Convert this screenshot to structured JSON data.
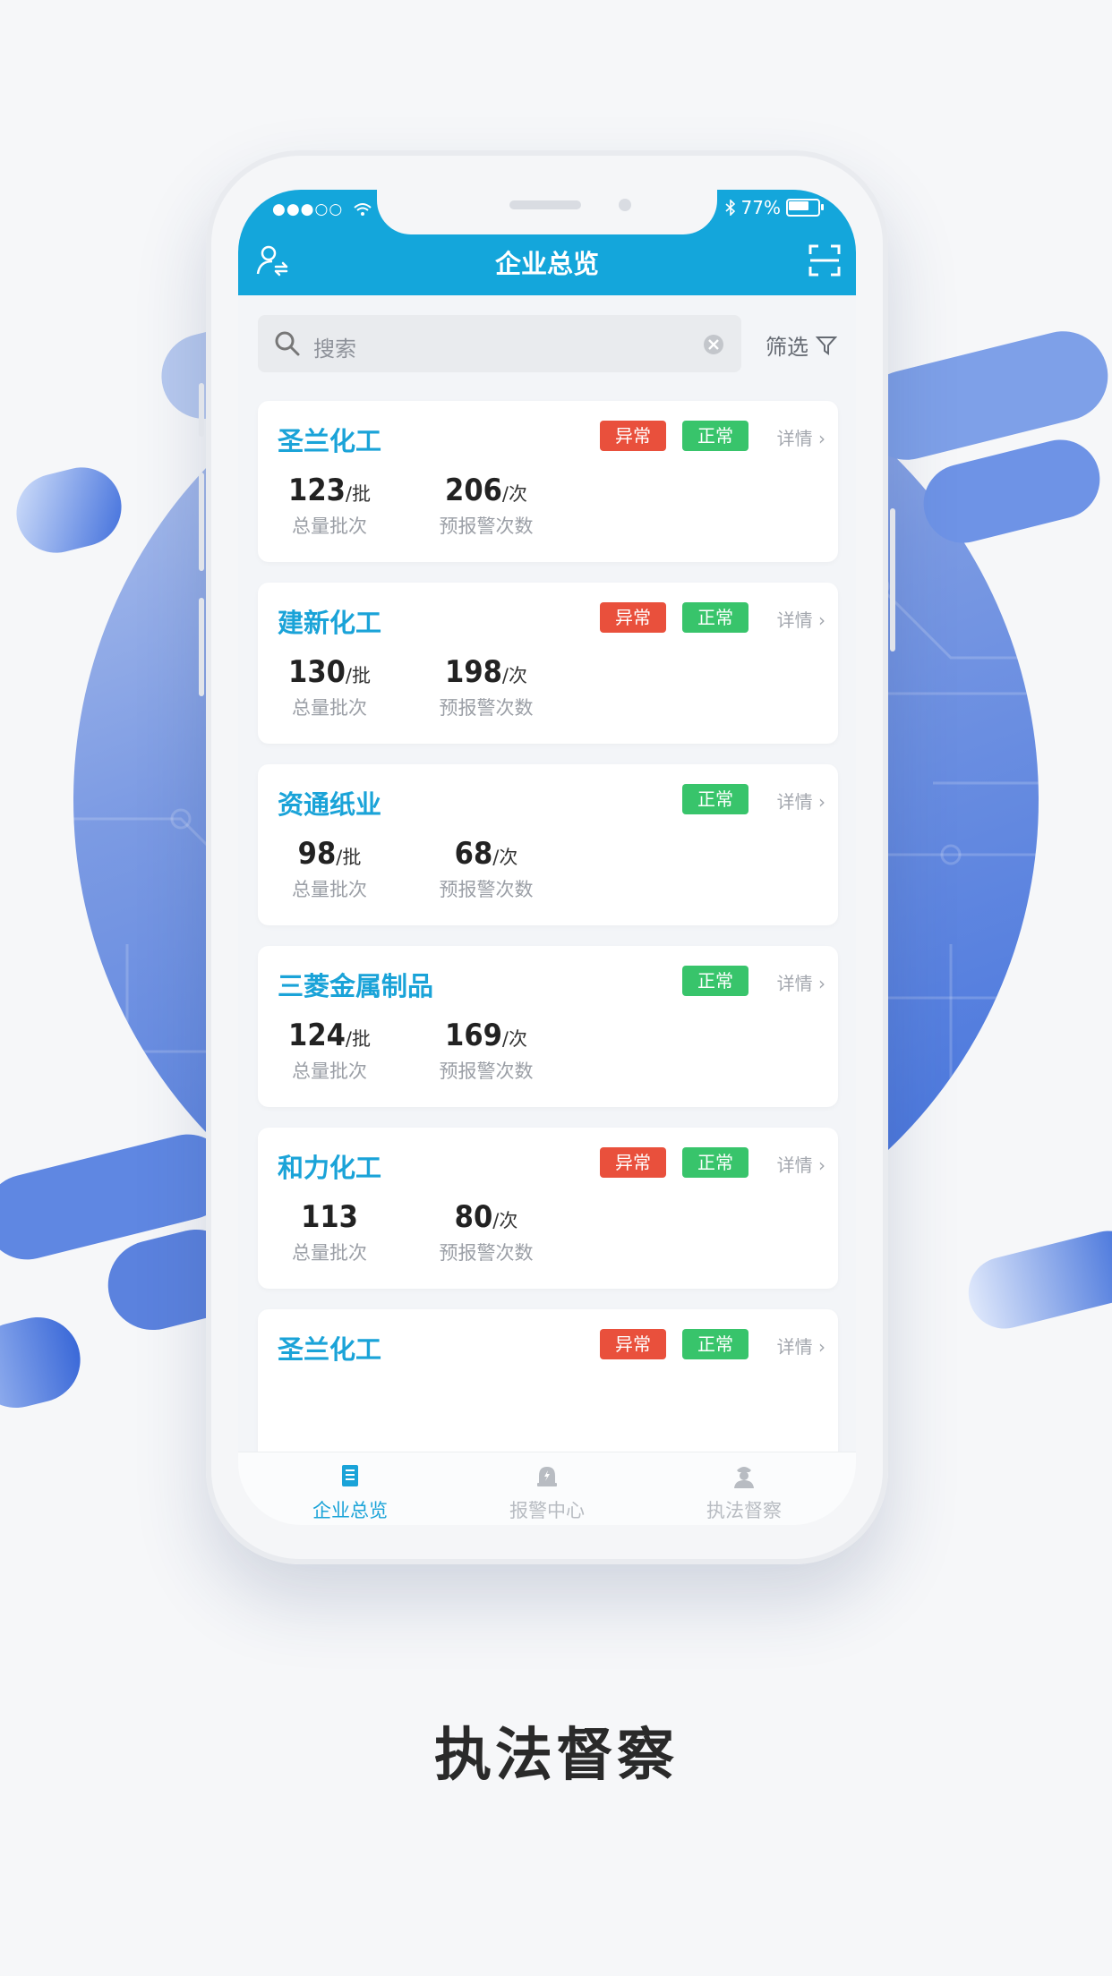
{
  "status_bar": {
    "signal": "●●●○○",
    "battery": "77%"
  },
  "header": {
    "title": "企业总览"
  },
  "search": {
    "placeholder": "搜索",
    "filter_label": "筛选"
  },
  "cards": [
    {
      "name": "圣兰化工",
      "abnormal": "异常",
      "normal": "正常",
      "detail": "详情",
      "batches": "123",
      "batches_unit": "/批",
      "alerts": "206",
      "alerts_unit": "/次",
      "batches_label": "总量批次",
      "alerts_label": "预报警次数"
    },
    {
      "name": "建新化工",
      "abnormal": "异常",
      "normal": "正常",
      "detail": "详情",
      "batches": "130",
      "batches_unit": "/批",
      "alerts": "198",
      "alerts_unit": "/次",
      "batches_label": "总量批次",
      "alerts_label": "预报警次数"
    },
    {
      "name": "资通纸业",
      "normal": "正常",
      "detail": "详情",
      "batches": "98",
      "batches_unit": "/批",
      "alerts": "68",
      "alerts_unit": "/次",
      "batches_label": "总量批次",
      "alerts_label": "预报警次数"
    },
    {
      "name": "三菱金属制品",
      "normal": "正常",
      "detail": "详情",
      "batches": "124",
      "batches_unit": "/批",
      "alerts": "169",
      "alerts_unit": "/次",
      "batches_label": "总量批次",
      "alerts_label": "预报警次数"
    },
    {
      "name": "和力化工",
      "abnormal": "异常",
      "normal": "正常",
      "detail": "详情",
      "batches": "113",
      "batches_unit": "",
      "alerts": "80",
      "alerts_unit": "/次",
      "batches_label": "总量批次",
      "alerts_label": "预报警次数"
    },
    {
      "name": "圣兰化工",
      "abnormal": "异常",
      "normal": "正常",
      "detail": "详情"
    }
  ],
  "tabs": [
    {
      "label": "企业总览",
      "active": true,
      "icon": "building-icon"
    },
    {
      "label": "报警中心",
      "active": false,
      "icon": "alarm-bell-icon"
    },
    {
      "label": "执法督察",
      "active": false,
      "icon": "officer-icon"
    }
  ],
  "caption": "执法督察",
  "colors": {
    "primary": "#14a6db",
    "abnormal": "#e9503c",
    "normal": "#38c46b",
    "inactive_tab": "#b8bcc2"
  }
}
